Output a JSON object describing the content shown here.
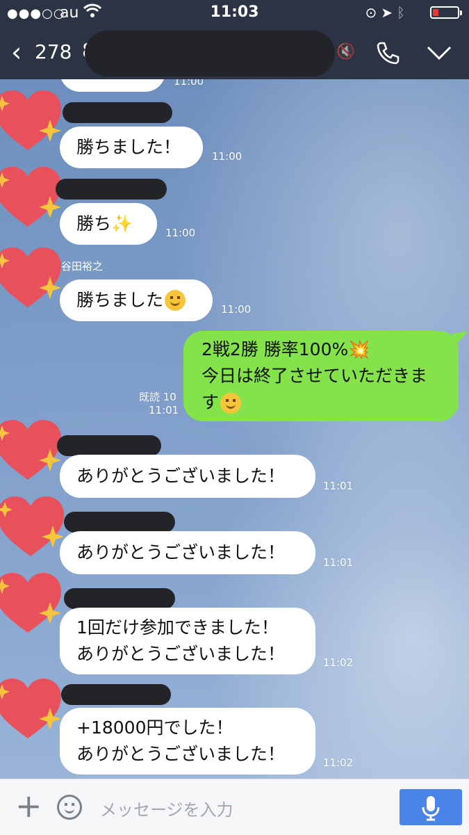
{
  "status_bar": {
    "signal": "●●●○○",
    "carrier": "au",
    "time": "11:03"
  },
  "header": {
    "back_count": "278",
    "title_partial": "8"
  },
  "messages": [
    {
      "time": "11:00"
    },
    {
      "text": "勝ちました！",
      "time": "11:00"
    },
    {
      "text": "勝ち✨",
      "time": "11:00"
    },
    {
      "sender": "谷田裕之",
      "text": "勝ちました",
      "time": "11:00"
    },
    {
      "lines": [
        "2戦2勝 勝率100%💥",
        "今日は終了させていただきま",
        "す"
      ],
      "read": "既読 10",
      "time": "11:01"
    },
    {
      "text": "ありがとうございました！",
      "time": "11:01"
    },
    {
      "text": "ありがとうございました！",
      "time": "11:01"
    },
    {
      "lines": [
        "1回だけ参加できました！",
        "ありがとうございました！"
      ],
      "time": "11:02"
    },
    {
      "lines": [
        "+18000円でした！",
        "ありがとうございました！"
      ],
      "time": "11:02"
    }
  ],
  "input_bar": {
    "placeholder": "メッセージを入力"
  },
  "colors": {
    "header_bg": "#2b3345",
    "outgoing_bubble": "#84e24b",
    "incoming_bubble": "#ffffff",
    "mic_button": "#4a84e6",
    "heart": "#e8505b",
    "sparkle": "#f7c53c"
  }
}
